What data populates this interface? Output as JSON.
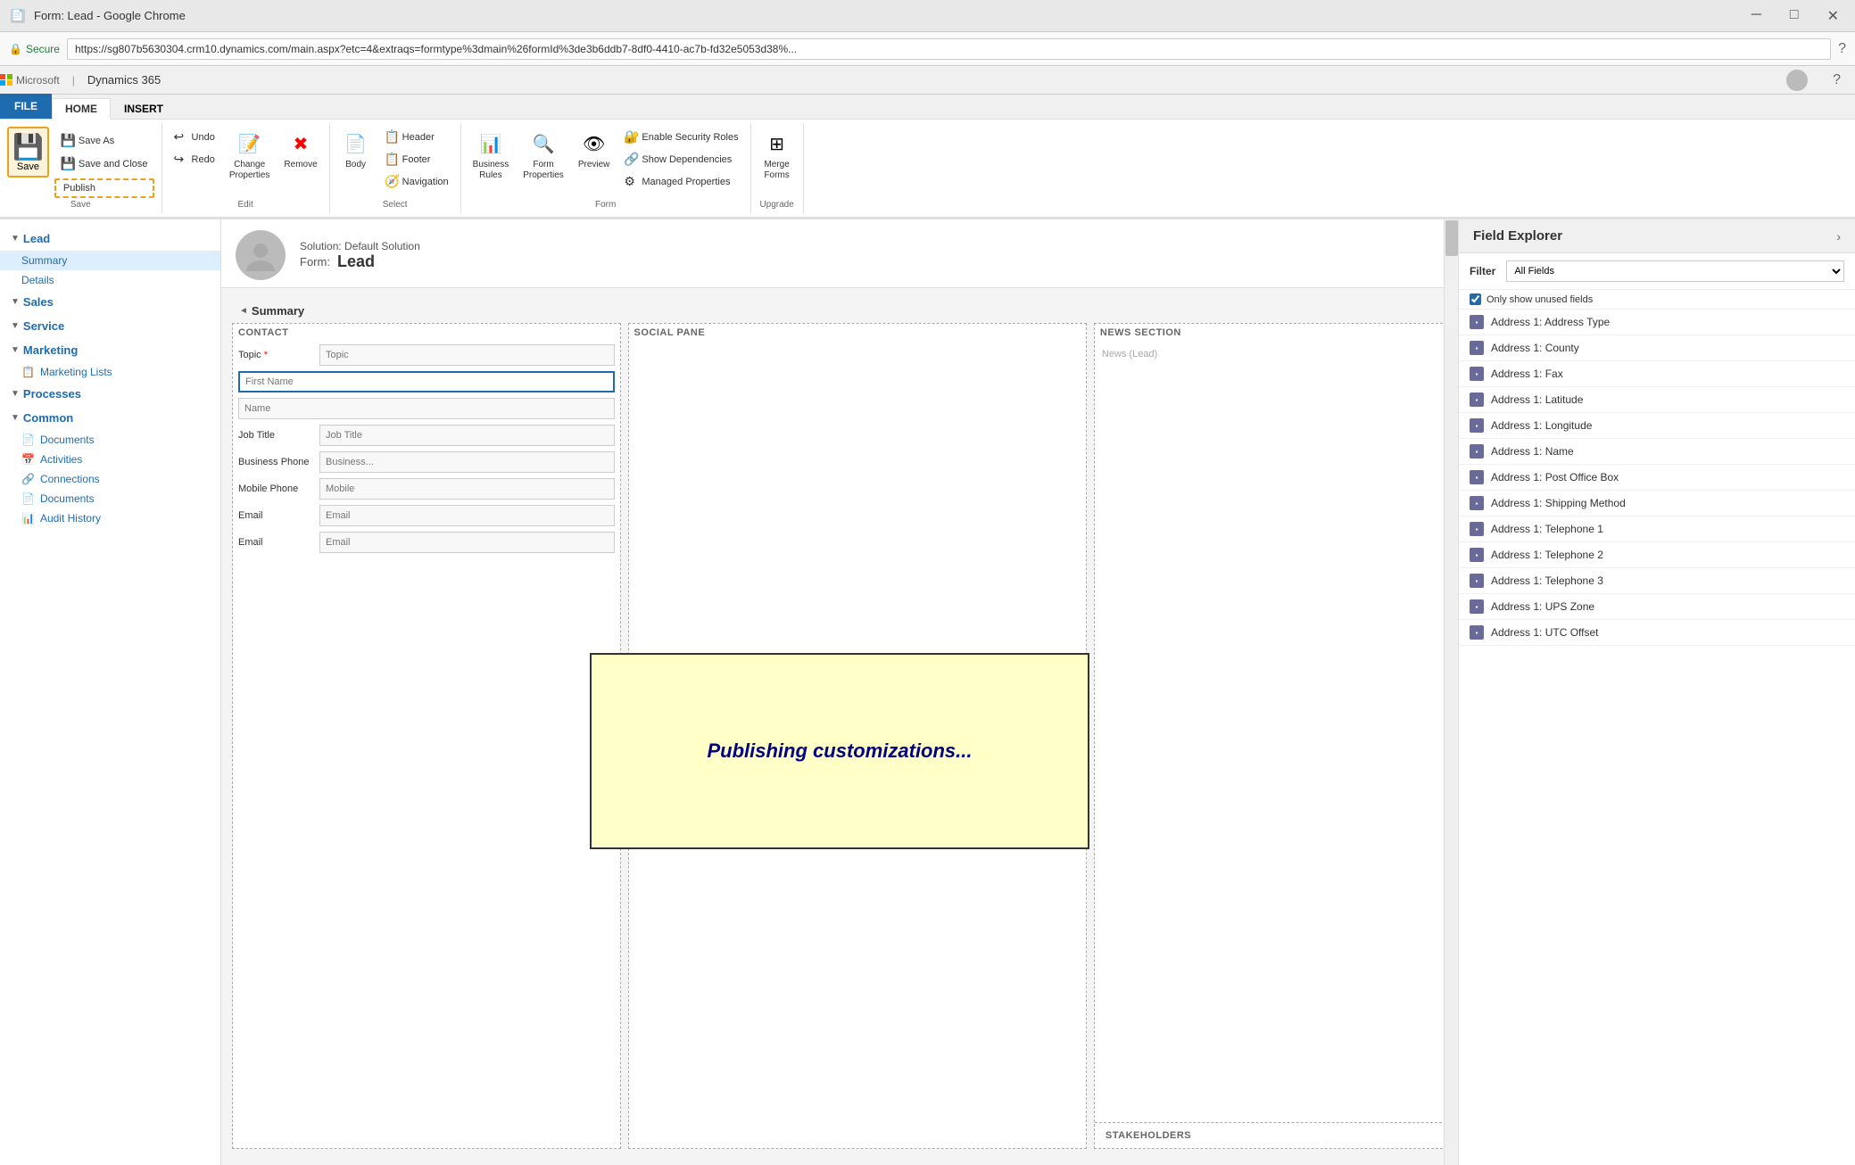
{
  "browser": {
    "favicon": "📄",
    "title": "Form: Lead - Google Chrome",
    "minimize": "─",
    "maximize": "□",
    "close": "✕",
    "secure_label": "Secure",
    "address": "https://sg807b5630304.crm10.dynamics.com/main.aspx?etc=4&extraqs=formtype%3dmain%26formId%3de3b6ddb7-8df0-4410-ac7b-fd32e5053d38%...",
    "help": "?"
  },
  "app_header": {
    "ms_label": "Microsoft",
    "separator": "|",
    "app_name": "Dynamics 365"
  },
  "ribbon": {
    "tabs": [
      {
        "label": "FILE",
        "key": "file"
      },
      {
        "label": "HOME",
        "key": "home",
        "active": true
      },
      {
        "label": "INSERT",
        "key": "insert"
      }
    ],
    "groups": {
      "save": {
        "label": "Save",
        "save_btn": "Save",
        "save_as_btn": "Save As",
        "save_close_btn": "Save and Close",
        "publish_btn": "Publish"
      },
      "edit": {
        "label": "Edit",
        "undo_btn": "Undo",
        "redo_btn": "Redo",
        "change_props_btn": "Change\nProperties",
        "remove_btn": "Remove"
      },
      "select": {
        "label": "Select",
        "header_btn": "Header",
        "footer_btn": "Footer",
        "body_btn": "Body",
        "navigation_btn": "Navigation"
      },
      "form": {
        "label": "Form",
        "business_rules_btn": "Business\nRules",
        "form_properties_btn": "Form\nProperties",
        "preview_btn": "Preview",
        "enable_security_btn": "Enable Security Roles",
        "show_deps_btn": "Show Dependencies",
        "managed_props_btn": "Managed Properties"
      },
      "upgrade": {
        "label": "Upgrade",
        "merge_forms_btn": "Merge\nForms"
      }
    }
  },
  "left_nav": {
    "sections": [
      {
        "title": "Lead",
        "items": [
          {
            "label": "Summary"
          },
          {
            "label": "Details"
          }
        ]
      },
      {
        "title": "Sales",
        "items": []
      },
      {
        "title": "Service",
        "items": []
      },
      {
        "title": "Marketing",
        "items": [
          {
            "label": "Marketing Lists",
            "icon": "📋"
          }
        ]
      },
      {
        "title": "Processes",
        "items": []
      },
      {
        "title": "Common",
        "items": [
          {
            "label": "Documents",
            "icon": "📄"
          },
          {
            "label": "Activities",
            "icon": "📅"
          },
          {
            "label": "Connections",
            "icon": "🔗"
          },
          {
            "label": "Documents",
            "icon": "📄"
          },
          {
            "label": "Audit History",
            "icon": "📊"
          }
        ]
      }
    ]
  },
  "form_header": {
    "solution_label": "Solution: Default Solution",
    "form_label": "Form:",
    "form_name": "Lead"
  },
  "form_body": {
    "summary_section": "Summary",
    "contact_pane": {
      "label": "CONTACT",
      "fields": [
        {
          "label": "Topic",
          "required": true,
          "placeholder": "Topic",
          "highlighted": false
        },
        {
          "label": "",
          "required": false,
          "placeholder": "First Name",
          "highlighted": true
        },
        {
          "label": "",
          "required": false,
          "placeholder": "Name",
          "highlighted": false
        },
        {
          "label": "Job Title",
          "required": false,
          "placeholder": "Job Title",
          "highlighted": false
        },
        {
          "label": "Business Phone",
          "required": false,
          "placeholder": "Business...",
          "highlighted": false
        },
        {
          "label": "Mobile Phone",
          "required": false,
          "placeholder": "Mobile",
          "highlighted": false
        },
        {
          "label": "Email",
          "required": false,
          "placeholder": "Email",
          "highlighted": false
        },
        {
          "label": "Email",
          "required": false,
          "placeholder": "Email",
          "highlighted": false
        }
      ]
    },
    "social_pane": {
      "label": "SOCIAL PANE"
    },
    "news_section": {
      "label": "News Section",
      "placeholder": "News (Lead)"
    },
    "stakeholders_label": "STAKEHOLDERS"
  },
  "publishing_overlay": {
    "text": "Publishing customizations..."
  },
  "field_explorer": {
    "title": "Field Explorer",
    "expand_icon": "›",
    "filter_label": "Filter",
    "filter_value": "All Fields",
    "only_unused_label": "Only show unused fields",
    "fields": [
      "Address 1: Address Type",
      "Address 1: County",
      "Address 1: Fax",
      "Address 1: Latitude",
      "Address 1: Longitude",
      "Address 1: Name",
      "Address 1: Post Office Box",
      "Address 1: Shipping Method",
      "Address 1: Telephone 1",
      "Address 1: Telephone 2",
      "Address 1: Telephone 3",
      "Address 1: UPS Zone",
      "Address 1: UTC Offset"
    ]
  }
}
